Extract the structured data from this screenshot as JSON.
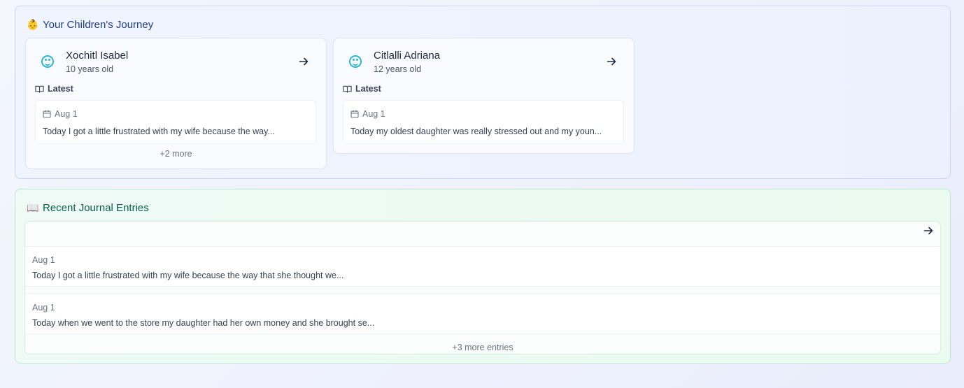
{
  "children_section": {
    "emoji": "👶",
    "title": "Your Children's Journey",
    "children": [
      {
        "name": "Xochitl Isabel",
        "age": "10 years old",
        "latest_label": "Latest",
        "entry_date": "Aug 1",
        "entry_text": "Today I got a little frustrated with my wife because the way...",
        "more": "+2 more"
      },
      {
        "name": "Citlalli Adriana",
        "age": "12 years old",
        "latest_label": "Latest",
        "entry_date": "Aug 1",
        "entry_text": "Today my oldest daughter was really stressed out and my youn..."
      }
    ]
  },
  "journal_section": {
    "emoji": "📖",
    "title": "Recent Journal Entries",
    "entries": [
      {
        "date": "Aug 1",
        "text": "Today I got a little frustrated with my wife because the way that she thought we..."
      },
      {
        "date": "Aug 1",
        "text": "Today when we went to the store my daughter had her own money and she brought se..."
      }
    ],
    "more": "+3 more entries"
  },
  "icons": {
    "child_avatar": "baby-face-icon",
    "arrow": "arrow-right-icon",
    "book": "book-open-icon",
    "calendar": "calendar-icon"
  },
  "colors": {
    "children_accent": "#1e3a8a",
    "journal_accent": "#065f46",
    "avatar": "#2cb4d9"
  }
}
